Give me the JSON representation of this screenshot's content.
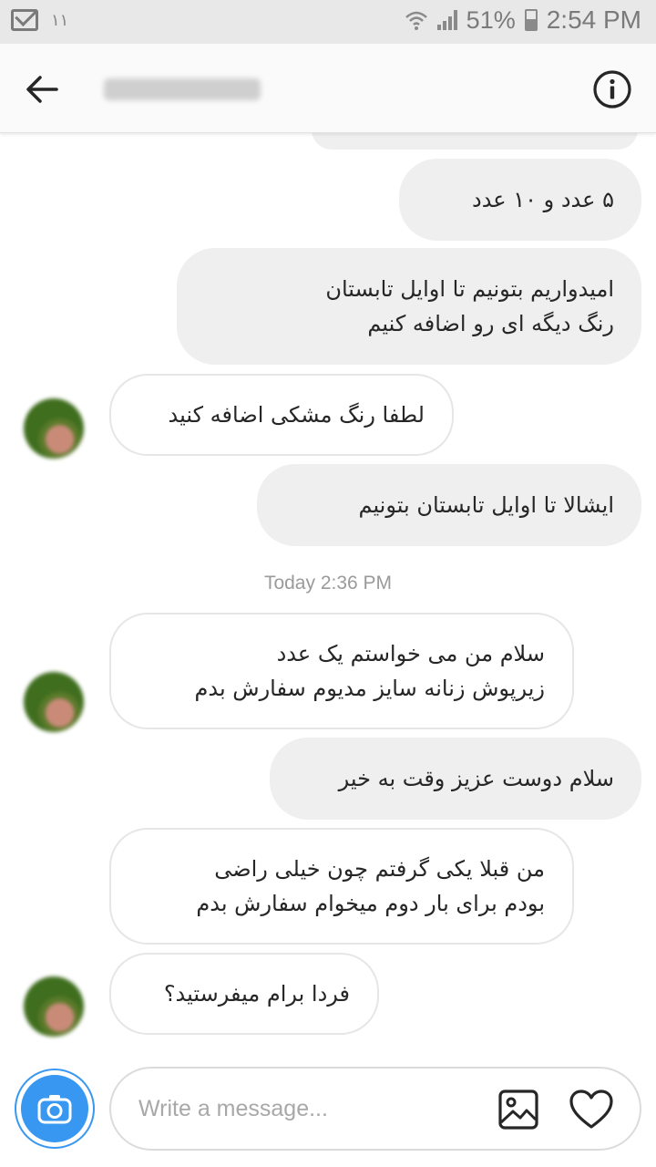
{
  "status_bar": {
    "notification_count": "۱۱",
    "battery_percent": "51%",
    "time": "2:54 PM"
  },
  "header": {
    "chat_title": "freshstation",
    "back_icon": "arrow-left-icon",
    "info_icon": "info-circle-icon"
  },
  "messages": [
    {
      "sender": "me",
      "text_lines": [
        "۵ عدد   و  ۱۰ عدد"
      ]
    },
    {
      "sender": "me",
      "text_lines": [
        "امیدواریم بتونیم  تا اوایل تابستان",
        "رنگ دیگه ای رو اضافه کنیم"
      ]
    },
    {
      "sender": "them",
      "text_lines": [
        "لطفا رنگ مشکی اضافه کنید"
      ]
    },
    {
      "sender": "me",
      "text_lines": [
        "ایشالا   تا اوایل تابستان  بتونیم"
      ]
    },
    {
      "sender": "them",
      "text_lines": [
        "سلام من می خواستم  یک عدد",
        "زیرپوش زنانه سایز مدیوم سفارش بدم"
      ]
    },
    {
      "sender": "me",
      "text_lines": [
        "سلام دوست عزیز وقت به خیر"
      ]
    },
    {
      "sender": "them",
      "text_lines": [
        "من قبلا یکی گرفتم چون خیلی راضی",
        "بودم برای بار دوم میخوام سفارش بدم"
      ]
    },
    {
      "sender": "them",
      "text_lines": [
        "فردا برام میفرستید؟"
      ]
    }
  ],
  "timestamp_divider": "Today 2:36 PM",
  "composer": {
    "placeholder": "Write a message...",
    "camera_icon": "camera-icon",
    "gallery_icon": "image-icon",
    "like_icon": "heart-icon"
  },
  "colors": {
    "accent": "#3897f0",
    "outgoing_bubble": "#efefef",
    "incoming_border": "#e6e6e6"
  }
}
